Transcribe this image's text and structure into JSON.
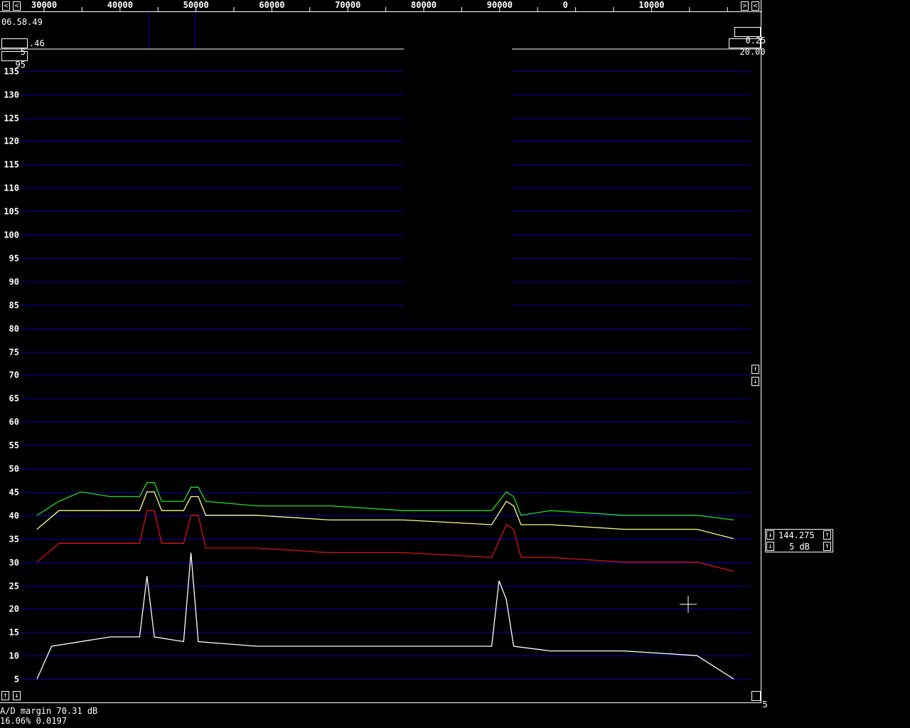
{
  "freq_scale": {
    "labels": [
      "30000",
      "40000",
      "50000",
      "60000",
      "70000",
      "80000",
      "90000",
      "0",
      "10000"
    ],
    "left_arrow": "<",
    "right_arrow": ">"
  },
  "waterfall": {
    "time": "06.58.49",
    "avg_count": "5",
    "avg_suffix": ".46",
    "gain": "0.25",
    "zero": "20.00"
  },
  "spectrum": {
    "top_level": "95",
    "y_labels": [
      "135",
      "130",
      "125",
      "120",
      "115",
      "110",
      "105",
      "100",
      "95",
      "90",
      "85",
      "80",
      "75",
      "70",
      "65",
      "60",
      "55",
      "50",
      "45",
      "40",
      "35",
      "30",
      "25",
      "20",
      "15",
      "10",
      "5"
    ],
    "bottom_right_value": "5",
    "up_arrow": "↑",
    "down_arrow": "↓",
    "colors": {
      "grid": "#0000aa",
      "green_trace": "#22dd22",
      "yellow_trace": "#ffff88",
      "red_trace": "#dd1111",
      "white_trace": "#ffffff"
    }
  },
  "side_panel": {
    "frequency": "144.275",
    "step": "5 dB"
  },
  "status": {
    "ad_margin": "A/D margin 70.31 dB",
    "cpu_line": "16.06% 0.0197"
  },
  "chart_data": {
    "type": "line",
    "title": "",
    "xlabel": "",
    "ylabel": "",
    "ylim": [
      0,
      138
    ],
    "yticks": [
      5,
      10,
      15,
      20,
      25,
      30,
      35,
      40,
      45,
      50,
      55,
      60,
      65,
      70,
      75,
      80,
      85,
      90,
      95,
      100,
      105,
      110,
      115,
      120,
      125,
      130,
      135
    ],
    "x_tick_labels": [
      "30000",
      "40000",
      "50000",
      "60000",
      "70000",
      "80000",
      "90000",
      "0",
      "10000"
    ],
    "series": [
      {
        "points": [
          [
            0,
            40
          ],
          [
            3,
            43
          ],
          [
            6,
            45
          ],
          [
            10,
            44
          ],
          [
            14,
            44
          ],
          [
            15,
            47
          ],
          [
            16,
            47
          ],
          [
            17,
            43
          ],
          [
            20,
            43
          ],
          [
            21,
            46
          ],
          [
            22,
            46
          ],
          [
            23,
            43
          ],
          [
            30,
            42
          ],
          [
            40,
            42
          ],
          [
            50,
            41
          ],
          [
            62,
            41
          ],
          [
            64,
            45
          ],
          [
            65,
            44
          ],
          [
            66,
            40
          ],
          [
            70,
            41
          ],
          [
            80,
            40
          ],
          [
            90,
            40
          ],
          [
            95,
            39
          ]
        ]
      },
      {
        "points": [
          [
            0,
            37
          ],
          [
            3,
            41
          ],
          [
            10,
            41
          ],
          [
            14,
            41
          ],
          [
            15,
            45
          ],
          [
            16,
            45
          ],
          [
            17,
            41
          ],
          [
            20,
            41
          ],
          [
            21,
            44
          ],
          [
            22,
            44
          ],
          [
            23,
            40
          ],
          [
            30,
            40
          ],
          [
            40,
            39
          ],
          [
            50,
            39
          ],
          [
            62,
            38
          ],
          [
            64,
            43
          ],
          [
            65,
            42
          ],
          [
            66,
            38
          ],
          [
            70,
            38
          ],
          [
            80,
            37
          ],
          [
            90,
            37
          ],
          [
            95,
            35
          ]
        ]
      },
      {
        "points": [
          [
            0,
            30
          ],
          [
            3,
            34
          ],
          [
            10,
            34
          ],
          [
            14,
            34
          ],
          [
            15,
            41
          ],
          [
            16,
            41
          ],
          [
            17,
            34
          ],
          [
            20,
            34
          ],
          [
            21,
            40
          ],
          [
            22,
            40
          ],
          [
            23,
            33
          ],
          [
            30,
            33
          ],
          [
            40,
            32
          ],
          [
            50,
            32
          ],
          [
            62,
            31
          ],
          [
            64,
            38
          ],
          [
            65,
            37
          ],
          [
            66,
            31
          ],
          [
            70,
            31
          ],
          [
            80,
            30
          ],
          [
            90,
            30
          ],
          [
            95,
            28
          ]
        ]
      },
      {
        "points": [
          [
            0,
            5
          ],
          [
            2,
            12
          ],
          [
            10,
            14
          ],
          [
            14,
            14
          ],
          [
            15,
            27
          ],
          [
            16,
            14
          ],
          [
            20,
            13
          ],
          [
            21,
            32
          ],
          [
            22,
            13
          ],
          [
            30,
            12
          ],
          [
            40,
            12
          ],
          [
            50,
            12
          ],
          [
            62,
            12
          ],
          [
            63,
            26
          ],
          [
            64,
            22
          ],
          [
            65,
            12
          ],
          [
            70,
            11
          ],
          [
            80,
            11
          ],
          [
            90,
            10
          ],
          [
            95,
            5
          ]
        ]
      }
    ]
  }
}
